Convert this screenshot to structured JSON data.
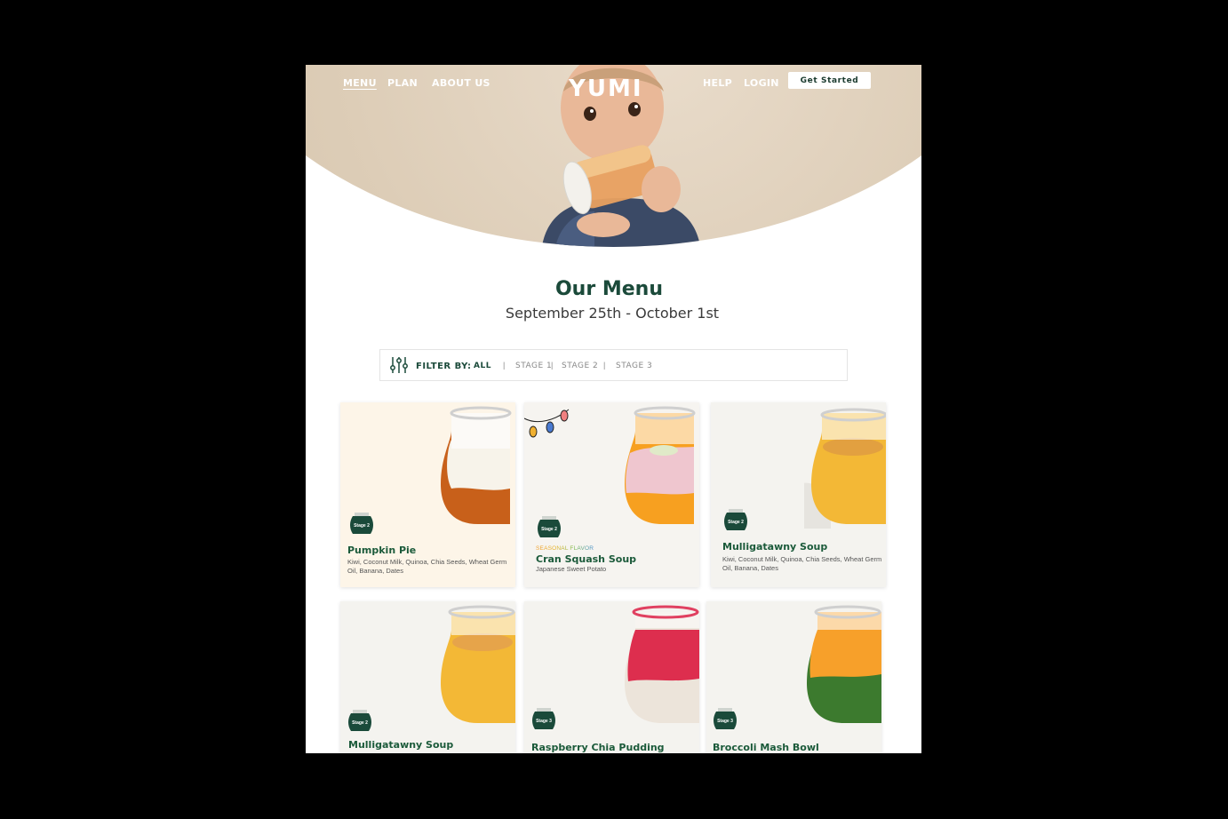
{
  "nav": {
    "left": [
      "MENU",
      "PLAN",
      "ABOUT US"
    ],
    "logo": "YUMI",
    "right": [
      "HELP",
      "LOGIN"
    ],
    "cta": "Get Started"
  },
  "header": {
    "title": "Our Menu",
    "date_range": "September 25th - October 1st"
  },
  "filter": {
    "label": "FILTER BY:",
    "options": [
      "ALL",
      "STAGE 1",
      "STAGE 2",
      "STAGE 3"
    ],
    "selected": "ALL"
  },
  "cards": [
    {
      "name": "Pumpkin Pie",
      "stage": "Stage 2",
      "seasonal": "",
      "ingredients": "Kiwi, Coconut Milk, Quinoa, Chia Seeds, Wheat Germ Oil, Banana, Dates"
    },
    {
      "name": "Cran Squash Soup",
      "stage": "Stage 2",
      "seasonal": "SEASONAL FLAVOR",
      "ingredients": "Japanese Sweet Potato"
    },
    {
      "name": "Mulligatawny Soup",
      "stage": "Stage 2",
      "seasonal": "",
      "ingredients": "Kiwi, Coconut Milk, Quinoa, Chia Seeds, Wheat Germ Oil, Banana, Dates"
    },
    {
      "name": "Mulligatawny Soup",
      "stage": "Stage 2",
      "seasonal": "",
      "ingredients": ""
    },
    {
      "name": "Raspberry Chia Pudding",
      "stage": "Stage 3",
      "seasonal": "",
      "ingredients": ""
    },
    {
      "name": "Broccoli Mash Bowl",
      "stage": "Stage 3",
      "seasonal": "",
      "ingredients": ""
    }
  ],
  "colors": {
    "brand_green": "#1b4a3a",
    "background": "#000000",
    "hero_beige": "#ddcdb7"
  }
}
